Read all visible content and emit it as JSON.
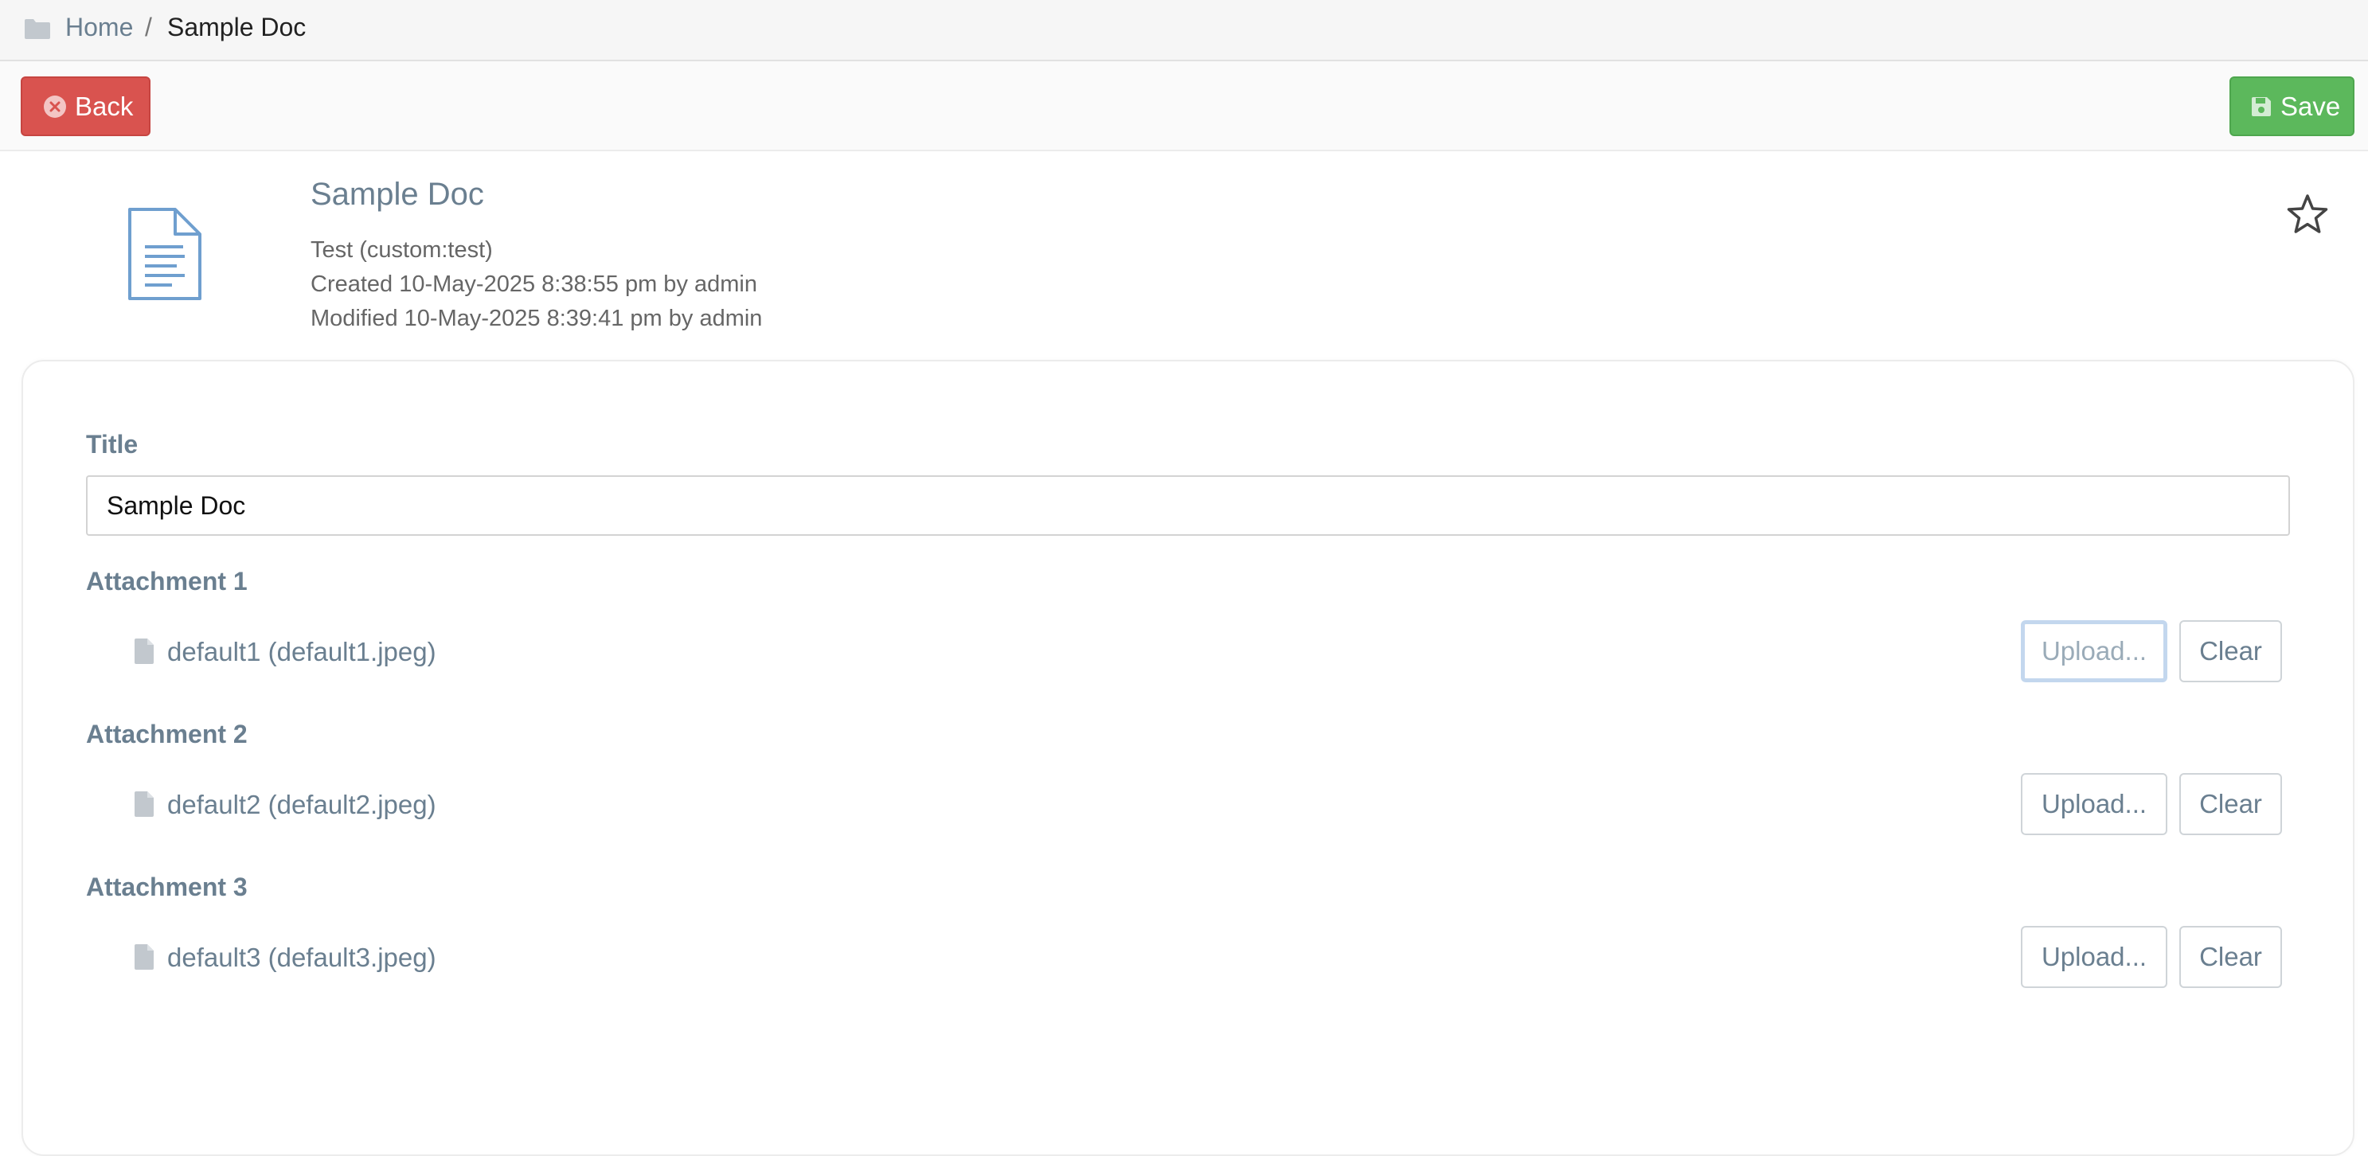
{
  "breadcrumb": {
    "folder_icon": "folder-icon",
    "home": "Home",
    "separator": "/",
    "current": "Sample Doc"
  },
  "toolbar": {
    "back_label": "Back",
    "back_icon": "close-circle-icon",
    "save_label": "Save",
    "save_icon": "floppy-disk-icon",
    "back_color": "#d9534f",
    "save_color": "#5cb85c"
  },
  "document": {
    "icon": "document-icon",
    "title": "Sample Doc",
    "type_line": "Test (custom:test)",
    "created_line": "Created 10-May-2025 8:38:55 pm by admin",
    "modified_line": "Modified 10-May-2025 8:39:41 pm by admin",
    "favorite_icon": "star-outline-icon"
  },
  "form": {
    "title_label": "Title",
    "title_value": "Sample Doc",
    "attachments": [
      {
        "label": "Attachment 1",
        "file": "default1 (default1.jpeg)",
        "upload": "Upload...",
        "clear": "Clear"
      },
      {
        "label": "Attachment 2",
        "file": "default2 (default2.jpeg)",
        "upload": "Upload...",
        "clear": "Clear"
      },
      {
        "label": "Attachment 3",
        "file": "default3 (default3.jpeg)",
        "upload": "Upload...",
        "clear": "Clear"
      }
    ]
  }
}
